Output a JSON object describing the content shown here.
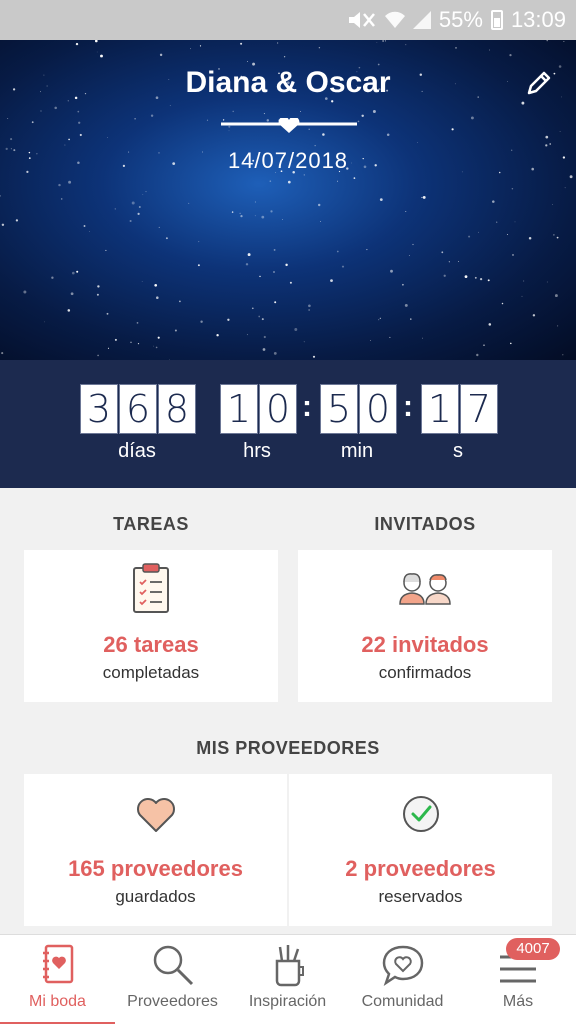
{
  "status_bar": {
    "battery": "55%",
    "time": "13:09"
  },
  "hero": {
    "couple": "Diana & Oscar",
    "date": "14/07/2018"
  },
  "countdown": {
    "days": [
      "3",
      "6",
      "8"
    ],
    "hours": [
      "1",
      "0"
    ],
    "minutes": [
      "5",
      "0"
    ],
    "seconds": [
      "1",
      "7"
    ],
    "separator": ":",
    "labels": {
      "days": "días",
      "hours": "hrs",
      "minutes": "min",
      "seconds": "s"
    }
  },
  "tareas": {
    "title": "TAREAS",
    "count": "26 tareas",
    "caption": "completadas"
  },
  "invitados": {
    "title": "INVITADOS",
    "count": "22 invitados",
    "caption": "confirmados"
  },
  "proveedores": {
    "title": "MIS PROVEEDORES",
    "saved": {
      "count": "165 proveedores",
      "caption": "guardados"
    },
    "booked": {
      "count": "2 proveedores",
      "caption": "reservados"
    }
  },
  "nav": {
    "items": [
      {
        "label": "Mi boda",
        "icon": "notebook-icon"
      },
      {
        "label": "Proveedores",
        "icon": "search-icon"
      },
      {
        "label": "Inspiración",
        "icon": "pencil-cup-icon"
      },
      {
        "label": "Comunidad",
        "icon": "chat-heart-icon"
      },
      {
        "label": "Más",
        "icon": "menu-icon"
      }
    ],
    "badge": "4007"
  },
  "colors": {
    "accent": "#e0605f",
    "navy": "#1c2a4f",
    "background": "#f1f1f1"
  }
}
